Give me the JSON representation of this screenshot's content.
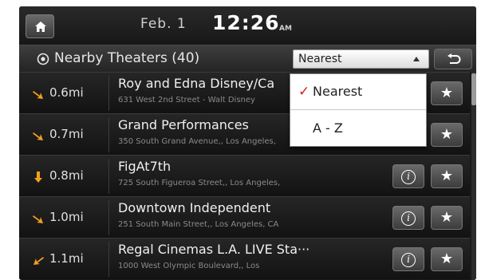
{
  "status": {
    "date": "Feb. 1",
    "time": "12:26",
    "ampm": "AM"
  },
  "header": {
    "title": "Nearby Theaters (40)",
    "sort_value": "Nearest"
  },
  "sort_options": [
    {
      "label": "Nearest",
      "selected": true
    },
    {
      "label": "A - Z",
      "selected": false
    }
  ],
  "theaters": [
    {
      "distance": "0.6mi",
      "name": "Roy and Edna Disney/Ca",
      "address": "631 West 2nd Street - Walt Disney",
      "direction": "southeast"
    },
    {
      "distance": "0.7mi",
      "name": "Grand Performances",
      "address": "350 South Grand Avenue,, Los Angeles,",
      "direction": "southeast"
    },
    {
      "distance": "0.8mi",
      "name": "FigAt7th",
      "address": "725 South Figueroa Street,, Los Angeles,",
      "direction": "south"
    },
    {
      "distance": "1.0mi",
      "name": "Downtown Independent",
      "address": "251 South Main Street,, Los Angeles, CA",
      "direction": "southeast"
    },
    {
      "distance": "1.1mi",
      "name": "Regal Cinemas L.A. LIVE Sta···",
      "address": "1000 West Olympic Boulevard,, Los",
      "direction": "southwest"
    }
  ],
  "icons": {
    "home": "home-icon",
    "back": "back-icon",
    "info": "info-icon",
    "star": "star-icon",
    "target": "target-icon"
  },
  "colors": {
    "accent_arrow": "#f0a020",
    "check": "#d42020"
  }
}
